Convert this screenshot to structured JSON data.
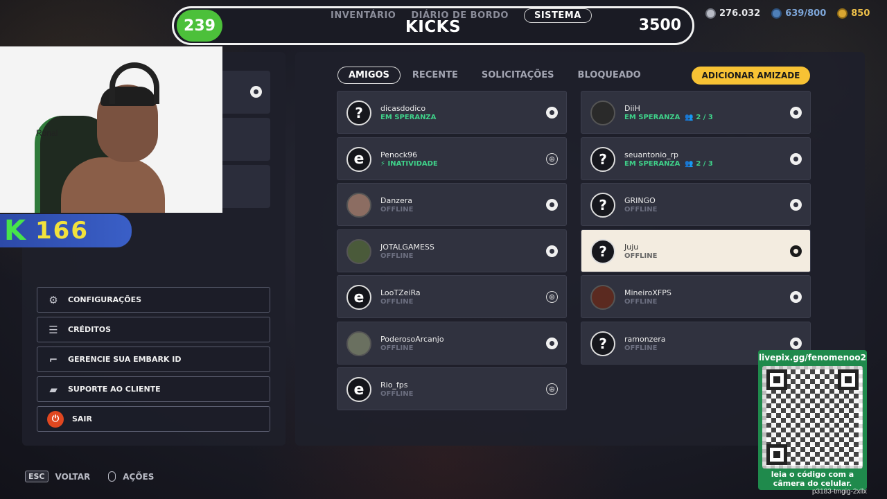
{
  "topbar": {
    "level": "239",
    "tabs": [
      "INVENTÁRIO",
      "DIÁRIO DE BORDO",
      "SISTEMA"
    ],
    "title": "KICKS",
    "score": "3500"
  },
  "currencies": [
    {
      "icon": "multibucks-icon",
      "value": "276.032"
    },
    {
      "icon": "tickets-icon",
      "value": "639/800"
    },
    {
      "icon": "vris-icon",
      "value": "850"
    }
  ],
  "stream_overlay": {
    "webcam_name": "Ronal",
    "kick_count": "166",
    "qr_url": "livepix.gg/fenomenoo2",
    "qr_caption_1": "leia o código com a",
    "qr_caption_2": "câmera do celular.",
    "stream_code": "p3183-tmgig-2xllx"
  },
  "menu": [
    {
      "label": "CONFIGURAÇÕES",
      "icon": "gear-icon"
    },
    {
      "label": "CRÉDITOS",
      "icon": "list-icon"
    },
    {
      "label": "GERENCIE SUA EMBARK ID",
      "icon": "boot-icon"
    },
    {
      "label": "SUPORTE AO CLIENTE",
      "icon": "chat-icon"
    },
    {
      "label": "SAIR",
      "icon": "power-icon"
    }
  ],
  "friend_tabs": [
    "AMIGOS",
    "RECENTE",
    "SOLICITAÇÕES",
    "BLOQUEADO"
  ],
  "add_friend_label": "ADICIONAR AMIZADE",
  "friends_left": [
    {
      "name": "dicasdodico",
      "status": "EM SPERANZA",
      "avatar": "?",
      "platform": "steam"
    },
    {
      "name": "Penock96",
      "status": "INATIVIDADE",
      "avatar": "e",
      "platform": "globe"
    },
    {
      "name": "Danzera",
      "status": "OFFLINE",
      "avatar": "",
      "platform": "steam"
    },
    {
      "name": "JOTALGAMESS",
      "status": "OFFLINE",
      "avatar": "",
      "platform": "steam"
    },
    {
      "name": "LooTZeiRa",
      "status": "OFFLINE",
      "avatar": "e",
      "platform": "globe"
    },
    {
      "name": "PoderosoArcanjo",
      "status": "OFFLINE",
      "avatar": "",
      "platform": "steam"
    },
    {
      "name": "Rio_fps",
      "status": "OFFLINE",
      "avatar": "e",
      "platform": "globe"
    }
  ],
  "friends_right": [
    {
      "name": "DiiH",
      "status": "EM SPERANZA",
      "party": "2 / 3",
      "avatar": "",
      "platform": "steam"
    },
    {
      "name": "seuantonio_rp",
      "status": "EM SPERANZA",
      "party": "2 / 3",
      "avatar": "?",
      "platform": "steam"
    },
    {
      "name": "GRINGO",
      "status": "OFFLINE",
      "avatar": "?",
      "platform": "steam"
    },
    {
      "name": "Juju",
      "status": "OFFLINE",
      "avatar": "?",
      "platform": "steam"
    },
    {
      "name": "MineiroXFPS",
      "status": "OFFLINE",
      "avatar": "",
      "platform": "steam"
    },
    {
      "name": "ramonzera",
      "status": "OFFLINE",
      "avatar": "?",
      "platform": "steam"
    }
  ],
  "hints": {
    "esc_key": "ESC",
    "back": "VOLTAR",
    "actions": "AÇÕES"
  }
}
